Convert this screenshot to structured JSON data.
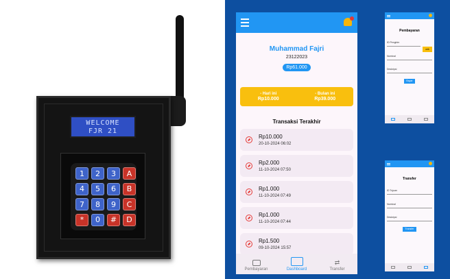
{
  "device": {
    "lcd_line1": "WELCOME",
    "lcd_line2": "FJR 21",
    "keys": [
      {
        "label": "1",
        "color": "blue"
      },
      {
        "label": "2",
        "color": "blue"
      },
      {
        "label": "3",
        "color": "blue"
      },
      {
        "label": "A",
        "color": "red"
      },
      {
        "label": "4",
        "color": "blue"
      },
      {
        "label": "5",
        "color": "blue"
      },
      {
        "label": "6",
        "color": "blue"
      },
      {
        "label": "B",
        "color": "red"
      },
      {
        "label": "7",
        "color": "blue"
      },
      {
        "label": "8",
        "color": "blue"
      },
      {
        "label": "9",
        "color": "blue"
      },
      {
        "label": "C",
        "color": "red"
      },
      {
        "label": "*",
        "color": "red"
      },
      {
        "label": "0",
        "color": "blue"
      },
      {
        "label": "#",
        "color": "red"
      },
      {
        "label": "D",
        "color": "red"
      }
    ]
  },
  "phone": {
    "user_name": "Muhammad Fajri",
    "user_id": "23122023",
    "balance": "Rp61.000",
    "stats": {
      "today_label": "- Hari ini",
      "today_value": "Rp10.000",
      "month_label": "- Bulan ini",
      "month_value": "Rp39.000"
    },
    "history_title": "Transaksi Terakhir",
    "history": [
      {
        "amount": "Rp10.000",
        "date": "20-10-2024 06:02"
      },
      {
        "amount": "Rp2.000",
        "date": "11-10-2024 07:50"
      },
      {
        "amount": "Rp1.000",
        "date": "11-10-2024 07:49"
      },
      {
        "amount": "Rp1.000",
        "date": "11-10-2024 07:44"
      },
      {
        "amount": "Rp1.500",
        "date": "09-10-2024 15:57"
      }
    ],
    "nav": {
      "pembayaran": "Pembayaran",
      "dashboard": "Dashboard",
      "transfer": "Transfer"
    }
  },
  "mini_pembayaran": {
    "title": "Pembayaran",
    "field1_label": "ID Pengirim",
    "cek_label": "cek",
    "field2_label": "Nominal",
    "field3_label": "Deskripsi",
    "button_label": "Bayar"
  },
  "mini_transfer": {
    "title": "Transfer",
    "field1_label": "ID Tujuan",
    "field2_label": "Nominal",
    "field3_label": "Deskripsi",
    "button_label": "Transfer"
  },
  "colors": {
    "primary": "#2196f3",
    "accent": "#f9bf0e",
    "panel": "#0d4fa0"
  }
}
